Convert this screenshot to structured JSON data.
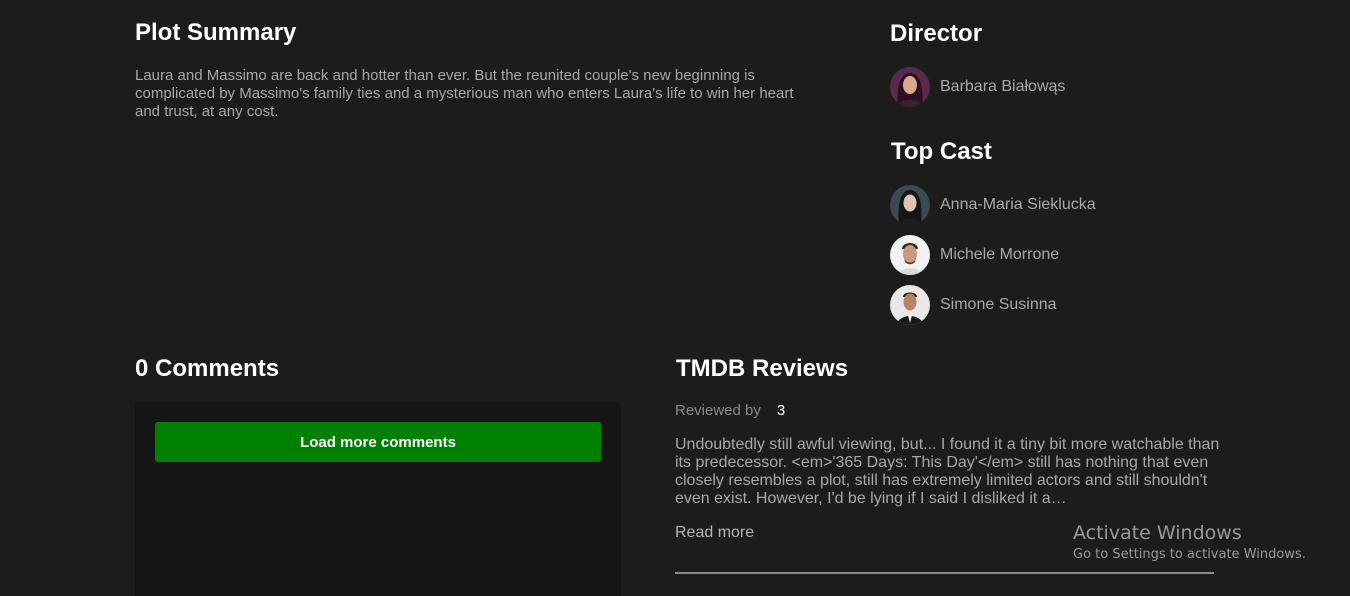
{
  "plot": {
    "title": "Plot Summary",
    "text": "Laura and Massimo are back and hotter than ever. But the reunited couple's new beginning is complicated by Massimo's family ties and a mysterious man who enters Laura's life to win her heart and trust, at any cost."
  },
  "director": {
    "title": "Director",
    "name": "Barbara Białowąs"
  },
  "cast": {
    "title": "Top Cast",
    "members": [
      {
        "name": "Anna-Maria Sieklucka"
      },
      {
        "name": "Michele Morrone"
      },
      {
        "name": "Simone Susinna"
      }
    ]
  },
  "comments": {
    "title": "0 Comments",
    "load_more_label": "Load more comments"
  },
  "reviews": {
    "title": "TMDB Reviews",
    "reviewed_by_label": "Reviewed by",
    "author": "3",
    "text": "Undoubtedly still awful viewing, but... I found it a tiny bit more watchable than its predecessor. <em>'365 Days: This Day'</em> still has nothing that even closely resembles a plot, still has extremely limited actors and still shouldn't even exist. However, I'd be lying if I said I disliked it a…",
    "read_more_label": "Read more"
  },
  "watermark": {
    "title": "Activate Windows",
    "subtitle": "Go to Settings to activate Windows."
  },
  "colors": {
    "background": "#1c1c1c",
    "panel": "#151515",
    "button": "#008000",
    "muted_text": "#a8a8a8"
  }
}
